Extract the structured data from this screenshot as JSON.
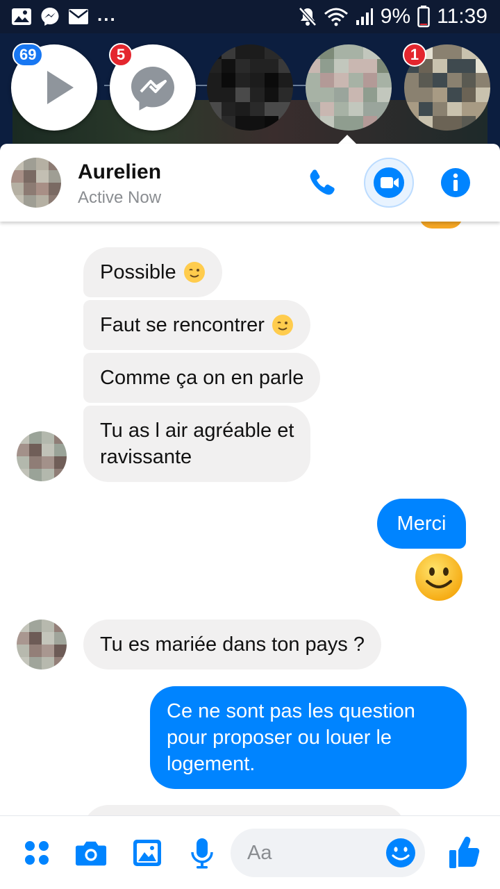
{
  "status_bar": {
    "battery": "9%",
    "time": "11:39",
    "more_indicator": "...",
    "icons": [
      "gallery-icon",
      "messenger-icon",
      "mail-icon",
      "mute-icon",
      "wifi-icon",
      "signal-icon",
      "battery-icon"
    ]
  },
  "chat_heads": [
    {
      "kind": "video",
      "badge": "69",
      "badge_color": "#1877f2"
    },
    {
      "kind": "messenger",
      "badge": "5",
      "badge_color": "#e4262e"
    },
    {
      "kind": "contact",
      "badge": ""
    },
    {
      "kind": "contact-active",
      "badge": ""
    },
    {
      "kind": "contact",
      "badge": "1",
      "badge_color": "#e4262e"
    }
  ],
  "conversation": {
    "name": "Aurelien",
    "status": "Active Now",
    "actions": [
      "phone-icon",
      "video-camera-icon",
      "info-icon"
    ]
  },
  "messages": [
    {
      "from": "them",
      "text": "Possible",
      "emoji": "wink"
    },
    {
      "from": "them",
      "text": "Faut se rencontrer",
      "emoji": "wink"
    },
    {
      "from": "them",
      "text": "Comme ça on en parle"
    },
    {
      "from": "them",
      "lines": [
        "Tu as l air agréable et",
        "ravissante"
      ]
    },
    {
      "from": "me",
      "text": "Merci"
    },
    {
      "from": "me",
      "emoji": "smile"
    },
    {
      "from": "them",
      "text": "Tu es mariée dans ton pays ?"
    },
    {
      "from": "me",
      "lines": [
        "Ce ne sont pas les question",
        "pour proposer ou louer le",
        "logement."
      ]
    }
  ],
  "composer": {
    "placeholder": "Aa",
    "icons": [
      "apps-icon",
      "camera-icon",
      "gallery-icon",
      "microphone-icon",
      "emoji-icon",
      "thumbs-up-icon"
    ]
  },
  "colors": {
    "accent": "#0084ff",
    "incoming_bubble": "#f1f0f0",
    "status_bar": "#0e1a33",
    "badge_red": "#e4262e",
    "badge_blue": "#1877f2"
  }
}
